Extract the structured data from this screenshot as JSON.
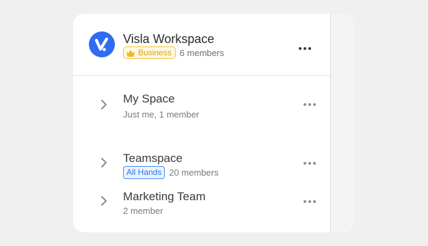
{
  "workspace": {
    "name": "Visla Workspace",
    "plan": "Business",
    "members": "6 members",
    "logo_icon": "visla-logo-icon",
    "accent": "#2f6bf3"
  },
  "spaces": [
    {
      "title": "My Space",
      "subtitle": "Just me, 1 member"
    },
    {
      "title": "Teamspace",
      "tag": "All Hands",
      "subtitle": "20 members"
    },
    {
      "title": "Marketing Team",
      "subtitle": "2 member"
    }
  ],
  "icons": {
    "expand": "chevron-right-icon",
    "more": "more-horizontal-icon",
    "plan": "crown-icon"
  }
}
